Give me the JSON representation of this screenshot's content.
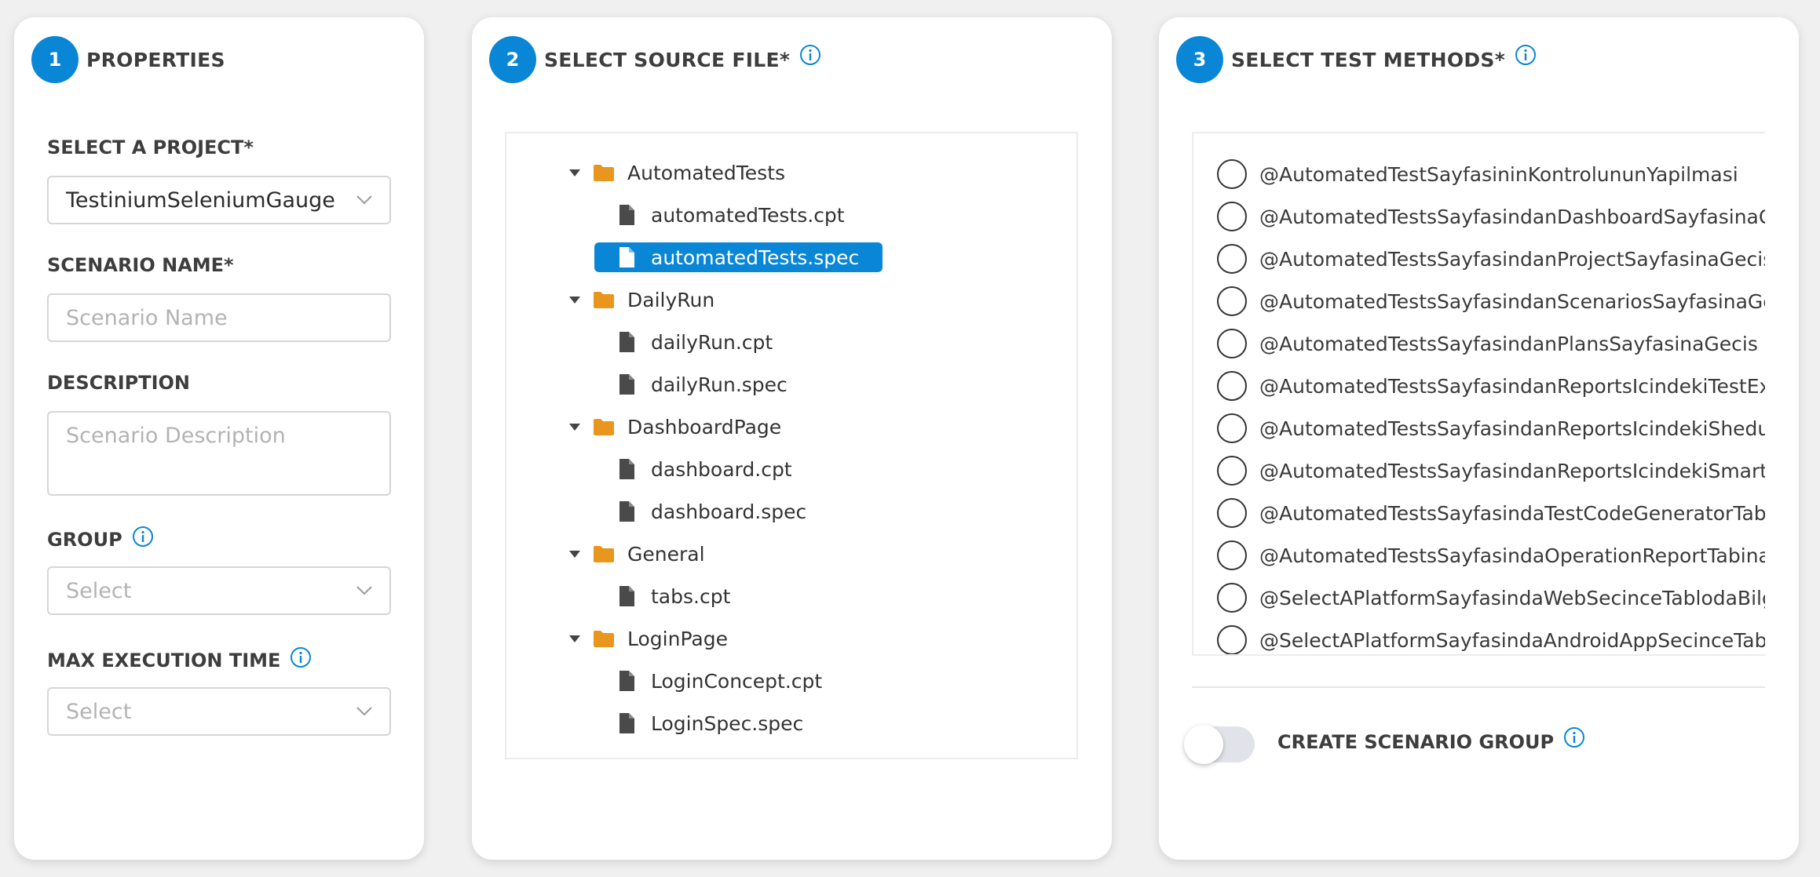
{
  "colors": {
    "accent": "#0a86d6",
    "folder": "#e8961e",
    "file": "#4a4a4a"
  },
  "properties": {
    "step": "1",
    "title": "PROPERTIES",
    "project_label": "SELECT A PROJECT*",
    "project_value": "TestiniumSeleniumGauge",
    "scenario_name_label": "SCENARIO NAME*",
    "scenario_name_placeholder": "Scenario Name",
    "description_label": "DESCRIPTION",
    "description_placeholder": "Scenario Description",
    "group_label": "GROUP",
    "group_placeholder": "Select",
    "max_exec_label": "MAX EXECUTION TIME",
    "max_exec_placeholder": "Select"
  },
  "source_file": {
    "step": "2",
    "title": "SELECT SOURCE FILE*",
    "tree": [
      {
        "type": "folder",
        "name": "AutomatedTests"
      },
      {
        "type": "file",
        "name": "automatedTests.cpt"
      },
      {
        "type": "file",
        "name": "automatedTests.spec",
        "selected": true
      },
      {
        "type": "folder",
        "name": "DailyRun"
      },
      {
        "type": "file",
        "name": "dailyRun.cpt"
      },
      {
        "type": "file",
        "name": "dailyRun.spec"
      },
      {
        "type": "folder",
        "name": "DashboardPage"
      },
      {
        "type": "file",
        "name": "dashboard.cpt"
      },
      {
        "type": "file",
        "name": "dashboard.spec"
      },
      {
        "type": "folder",
        "name": "General"
      },
      {
        "type": "file",
        "name": "tabs.cpt"
      },
      {
        "type": "folder",
        "name": "LoginPage"
      },
      {
        "type": "file",
        "name": "LoginConcept.cpt"
      },
      {
        "type": "file",
        "name": "LoginSpec.spec"
      }
    ]
  },
  "test_methods": {
    "step": "3",
    "title": "SELECT TEST METHODS*",
    "methods": [
      "@AutomatedTestSayfasininKontrolununYapilmasi",
      "@AutomatedTestsSayfasindanDashboardSayfasinaGecis",
      "@AutomatedTestsSayfasindanProjectSayfasinaGecis",
      "@AutomatedTestsSayfasindanScenariosSayfasinaGecis",
      "@AutomatedTestsSayfasindanPlansSayfasinaGecis",
      "@AutomatedTestsSayfasindanReportsIcindekiTestExecution",
      "@AutomatedTestsSayfasindanReportsIcindekiShedule",
      "@AutomatedTestsSayfasindanReportsIcindekiSmartReport",
      "@AutomatedTestsSayfasindaTestCodeGeneratorTabina",
      "@AutomatedTestsSayfasindaOperationReportTabinaGecis",
      "@SelectAPlatformSayfasindaWebSecinceTablodaBilgi",
      "@SelectAPlatformSayfasindaAndroidAppSecinceTablo"
    ],
    "create_group_label": "CREATE SCENARIO GROUP",
    "create_group_enabled": false
  }
}
